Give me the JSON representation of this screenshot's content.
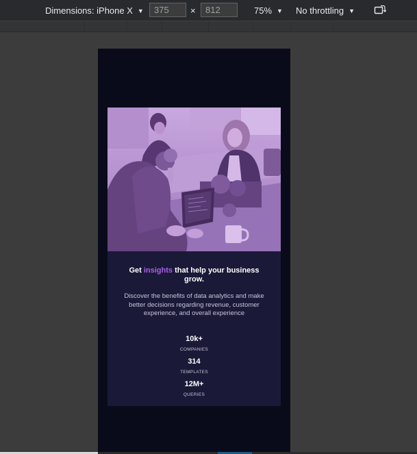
{
  "devtools": {
    "dimensions_label": "Dimensions: iPhone X",
    "width_value": "375",
    "height_value": "812",
    "times_symbol": "×",
    "zoom": "75%",
    "throttling": "No throttling"
  },
  "card": {
    "headline_prefix": "Get ",
    "headline_accent": "insights",
    "headline_suffix": " that help your business grow.",
    "description": "Discover the benefits of data analytics and make better decisions regarding revenue, customer experience, and overall experience",
    "stats": [
      {
        "value": "10k+",
        "label": "COMPANIES"
      },
      {
        "value": "314",
        "label": "TEMPLATES"
      },
      {
        "value": "12M+",
        "label": "QUERIES"
      }
    ]
  },
  "colors": {
    "page_bg": "#090b1a",
    "card_bg": "#1b1938",
    "accent": "#a95fe7",
    "image_tint": "#aa5cdb"
  }
}
